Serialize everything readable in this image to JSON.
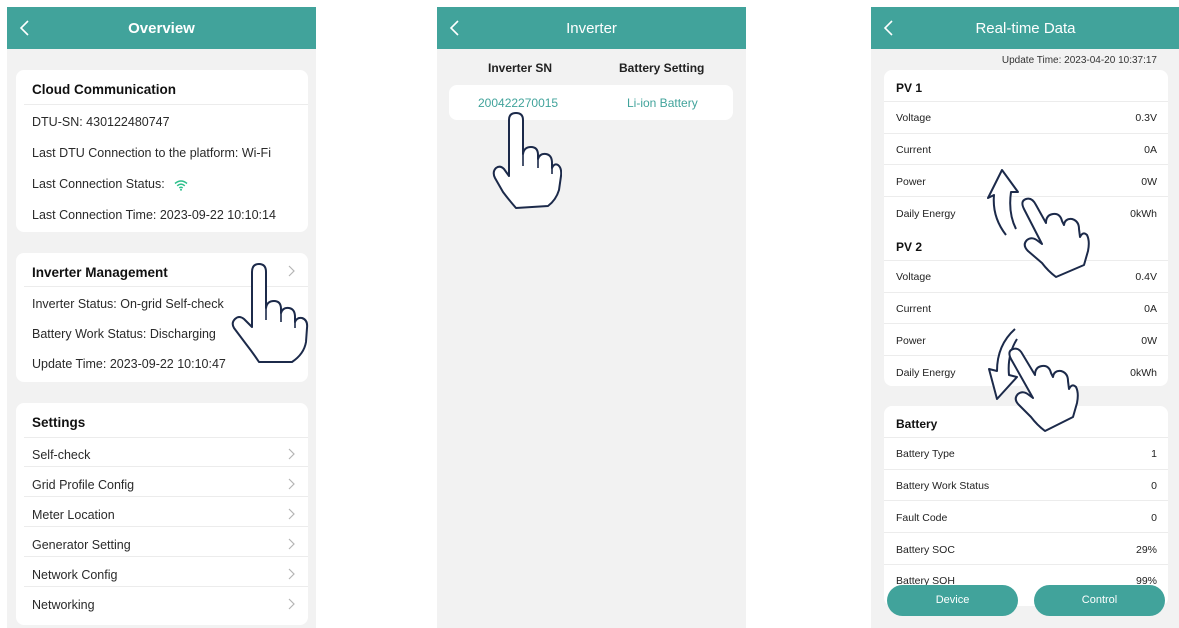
{
  "overview": {
    "title": "Overview",
    "cloud": {
      "header": "Cloud Communication",
      "rows": [
        "DTU-SN:  430122480747",
        "Last DTU Connection to the platform:  Wi-Fi",
        "Last Connection Status:",
        "Last Connection Time:  2023-09-22 10:10:14"
      ]
    },
    "inverter_mgmt": {
      "header": "Inverter Management",
      "rows": [
        "Inverter Status:  On-grid Self-check",
        "Battery Work Status:  Discharging",
        "Update Time:  2023-09-22 10:10:47"
      ]
    },
    "settings": {
      "header": "Settings",
      "items": [
        "Self-check",
        "Grid Profile Config",
        "Meter Location",
        "Generator Setting",
        "Network Config",
        "Networking"
      ]
    }
  },
  "inverter": {
    "title": "Inverter",
    "col_sn": "Inverter SN",
    "col_battery": "Battery Setting",
    "row": {
      "sn": "200422270015",
      "battery": "Li-ion Battery"
    }
  },
  "realtime": {
    "title": "Real-time Data",
    "update_time": "Update Time: 2023-04-20 10:37:17",
    "pv1": {
      "header": "PV 1",
      "rows": [
        {
          "label": "Voltage",
          "value": "0.3V"
        },
        {
          "label": "Current",
          "value": "0A"
        },
        {
          "label": "Power",
          "value": "0W"
        },
        {
          "label": "Daily Energy",
          "value": "0kWh"
        }
      ]
    },
    "pv2": {
      "header": "PV 2",
      "rows": [
        {
          "label": "Voltage",
          "value": "0.4V"
        },
        {
          "label": "Current",
          "value": "0A"
        },
        {
          "label": "Power",
          "value": "0W"
        },
        {
          "label": "Daily Energy",
          "value": "0kWh"
        }
      ]
    },
    "battery": {
      "header": "Battery",
      "rows": [
        {
          "label": "Battery Type",
          "value": "1"
        },
        {
          "label": "Battery Work Status",
          "value": "0"
        },
        {
          "label": "Fault Code",
          "value": "0"
        },
        {
          "label": "Battery SOC",
          "value": "29%"
        },
        {
          "label": "Battery SOH",
          "value": "99%"
        }
      ]
    },
    "buttons": {
      "device": "Device",
      "control": "Control"
    }
  },
  "colors": {
    "accent": "#41a39b",
    "background": "#f2f2f2",
    "card": "#ffffff"
  }
}
